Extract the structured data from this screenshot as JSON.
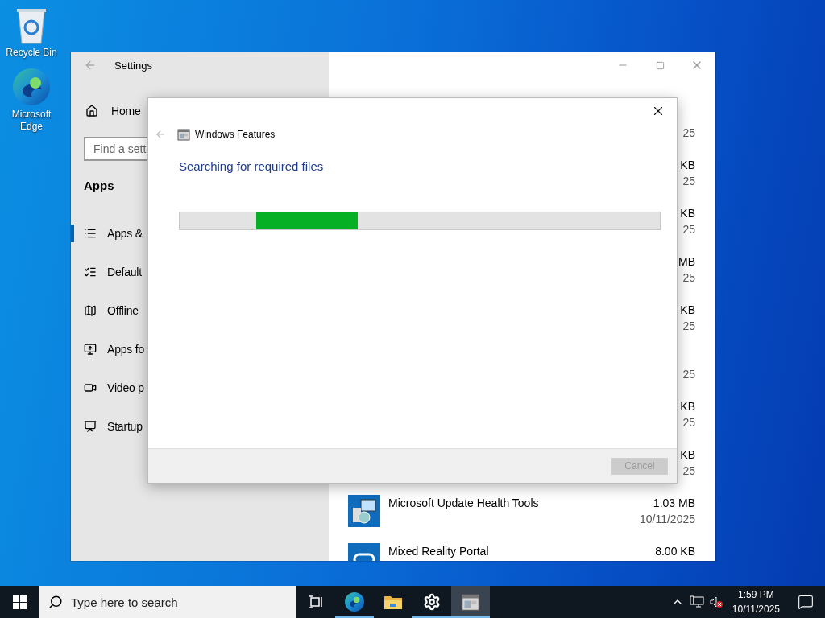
{
  "desktop_icons": [
    {
      "label": "Recycle Bin",
      "kind": "recycle"
    },
    {
      "label": "Microsoft Edge",
      "kind": "edge"
    }
  ],
  "settings": {
    "title": "Settings",
    "home": "Home",
    "search": {
      "placeholder": "Find a setti"
    },
    "section": "Apps",
    "items": [
      {
        "label": "Apps &",
        "kind": "list",
        "selected": true
      },
      {
        "label": "Default",
        "kind": "defaults",
        "selected": false
      },
      {
        "label": "Offline",
        "kind": "map",
        "selected": false
      },
      {
        "label": "Apps fo",
        "kind": "websites",
        "selected": false
      },
      {
        "label": "Video p",
        "kind": "video",
        "selected": false
      },
      {
        "label": "Startup",
        "kind": "startup",
        "selected": false
      }
    ],
    "apps": [
      {
        "date": "25"
      },
      {
        "size": "KB",
        "date": "25"
      },
      {
        "size": "KB",
        "date": "25"
      },
      {
        "size": "MB",
        "date": "25"
      },
      {
        "size": "KB",
        "date": "25"
      },
      {
        "date": "25"
      },
      {
        "size": "KB",
        "date": "25"
      },
      {
        "size": "KB",
        "date": "25"
      },
      {
        "name": "Microsoft Update Health Tools",
        "kind": "installer",
        "size": "1.03 MB",
        "date": "10/11/2025"
      },
      {
        "name": "Mixed Reality Portal",
        "kind": "headset",
        "size": "8.00 KB"
      }
    ]
  },
  "dialog": {
    "title": "Windows Features",
    "status": "Searching for required files",
    "progress": {
      "level": 0.21
    },
    "cancel": {
      "label": "Cancel",
      "disabled": true
    }
  },
  "taskbar": {
    "search": {
      "placeholder": "Type here to search"
    },
    "apps": [
      {
        "kind": "taskview",
        "running": false,
        "selected": false
      },
      {
        "kind": "edge",
        "running": true,
        "selected": false
      },
      {
        "kind": "folder",
        "running": false,
        "selected": false
      },
      {
        "kind": "gear",
        "running": true,
        "selected": false
      },
      {
        "kind": "features",
        "running": true,
        "selected": true
      }
    ],
    "clock": {
      "time": "1:59 PM",
      "date": "10/11/2025"
    }
  }
}
